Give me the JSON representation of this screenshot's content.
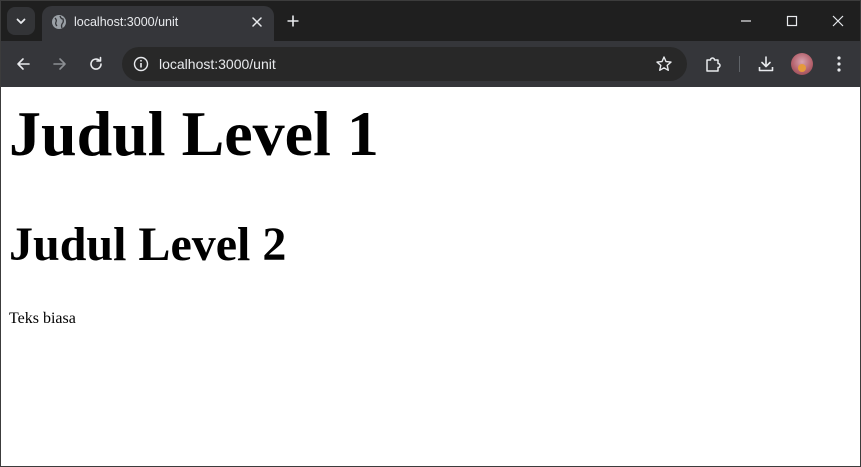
{
  "browser": {
    "tab": {
      "title": "localhost:3000/unit"
    },
    "omnibox": {
      "url": "localhost:3000/unit"
    }
  },
  "page": {
    "heading1": "Judul Level 1",
    "heading2": "Judul Level 2",
    "paragraph": "Teks biasa"
  },
  "colors": {
    "chrome_dark": "#1f1f1f",
    "toolbar": "#35363a",
    "omnibox": "#282828",
    "page_bg": "#ffffff",
    "text_light": "#e8eaed"
  }
}
